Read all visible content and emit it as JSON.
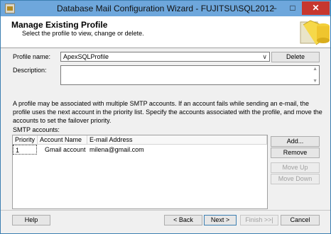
{
  "window": {
    "title": "Database Mail Configuration Wizard - FUJITSU\\SQL2012",
    "minimize": "–",
    "maximize": "□",
    "close": "✕"
  },
  "header": {
    "title": "Manage Existing Profile",
    "subtitle": "Select the profile to view, change or delete."
  },
  "form": {
    "profile_label": "Profile name:",
    "profile_value": "ApexSQLProfile",
    "dropdown_arrow": "∨",
    "delete_label": "Delete",
    "description_label": "Description:",
    "description_value": ""
  },
  "info_text": "A profile may be associated with multiple SMTP accounts. If an account fails while sending an e-mail, the profile uses the next account in the priority list. Specify the accounts associated with the profile, and move the accounts to set the failover priority.",
  "smtp": {
    "label": "SMTP accounts:",
    "columns": [
      "Priority",
      "Account Name",
      "E-mail Address"
    ],
    "rows": [
      {
        "priority": "1",
        "account": "Gmail account",
        "email": "milena@gmail.com"
      }
    ],
    "add_label": "Add...",
    "remove_label": "Remove",
    "move_up_label": "Move Up",
    "move_down_label": "Move Down"
  },
  "footer": {
    "help_label": "Help",
    "back_label": "< Back",
    "next_label": "Next >",
    "finish_label": "Finish >>|",
    "cancel_label": "Cancel"
  }
}
